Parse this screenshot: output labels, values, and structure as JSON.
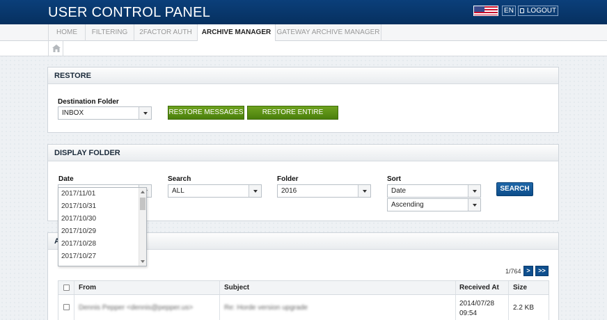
{
  "header": {
    "title": "USER CONTROL PANEL",
    "lang": "EN",
    "logout": "LOGOUT",
    "flag_icon": "us-flag-icon",
    "lock_icon": "lock-icon"
  },
  "tabs": [
    {
      "label": "HOME"
    },
    {
      "label": "FILTERING"
    },
    {
      "label": "2FACTOR AUTH"
    },
    {
      "label": "ARCHIVE MANAGER"
    },
    {
      "label": "GATEWAY ARCHIVE MANAGER"
    }
  ],
  "breadcrumb": {
    "home_icon": "home-icon"
  },
  "restore": {
    "title": "RESTORE",
    "dest_label": "Destination Folder",
    "dest_value": "INBOX",
    "btn_messages": "RESTORE MESSAGES",
    "btn_folder": "RESTORE ENTIRE FOLDER"
  },
  "display": {
    "title": "DISPLAY FOLDER",
    "date_label": "Date",
    "search_label": "Search",
    "search_value": "ALL",
    "folder_label": "Folder",
    "folder_value": "2016",
    "sort_label": "Sort",
    "sort_value": "Date",
    "order_value": "Ascending",
    "search_button": "SEARCH",
    "date_options": [
      "2017/11/01",
      "2017/10/31",
      "2017/10/30",
      "2017/10/29",
      "2017/10/28",
      "2017/10/27"
    ]
  },
  "archive": {
    "title_partial": "A",
    "page_info": "1/764",
    "next": ">",
    "last": ">>",
    "columns": [
      "From",
      "Subject",
      "Received At",
      "Size"
    ],
    "rows": [
      {
        "from": "Dennis Pepper <dennis@pepper.us>",
        "subject": "Re: Horde version upgrade",
        "received_date": "2014/07/28",
        "received_time": "09:54",
        "size": "2.2 KB"
      }
    ]
  },
  "colors": {
    "header": "#0b3f7a",
    "green": "#5a8f14",
    "blue_btn": "#0f4f8e"
  }
}
